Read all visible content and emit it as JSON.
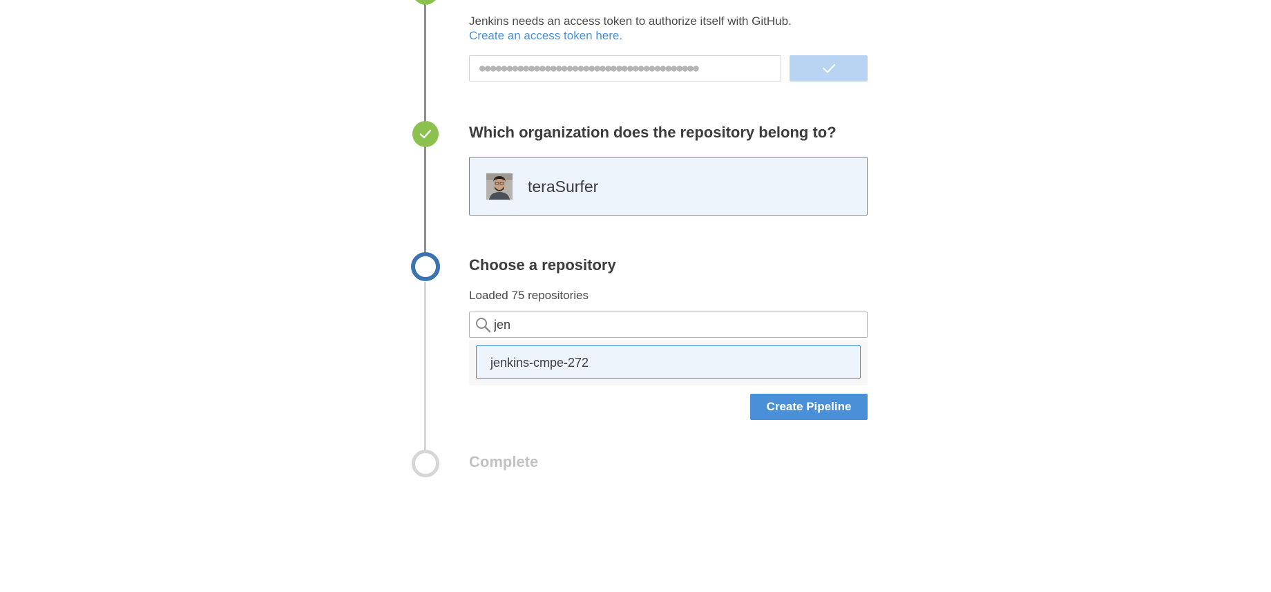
{
  "steps": {
    "access_token": {
      "description": "Jenkins needs an access token to authorize itself with GitHub.",
      "link_label": "Create an access token here.",
      "masked_value": "●●●●●●●●●●●●●●●●●●●●●●●●●●●●●●●●●●●●●●●●",
      "status": "complete"
    },
    "organization": {
      "title": "Which organization does the repository belong to?",
      "selected_org": "teraSurfer",
      "status": "complete"
    },
    "repository": {
      "title": "Choose a repository",
      "loaded_text": "Loaded 75 repositories",
      "search_value": "jen",
      "results": [
        "jenkins-cmpe-272"
      ],
      "create_button_label": "Create Pipeline",
      "status": "active"
    },
    "complete": {
      "title": "Complete",
      "status": "pending"
    }
  },
  "colors": {
    "complete_green": "#8cc04f",
    "active_blue": "#3d74b0",
    "pending_gray": "#d6d6d6",
    "accent_blue": "#4a90d9",
    "selected_bg": "#eef4fc"
  },
  "icons": {
    "step_complete": "checkmark-icon",
    "search": "magnifier-icon",
    "token_validated": "checkmark-icon"
  }
}
